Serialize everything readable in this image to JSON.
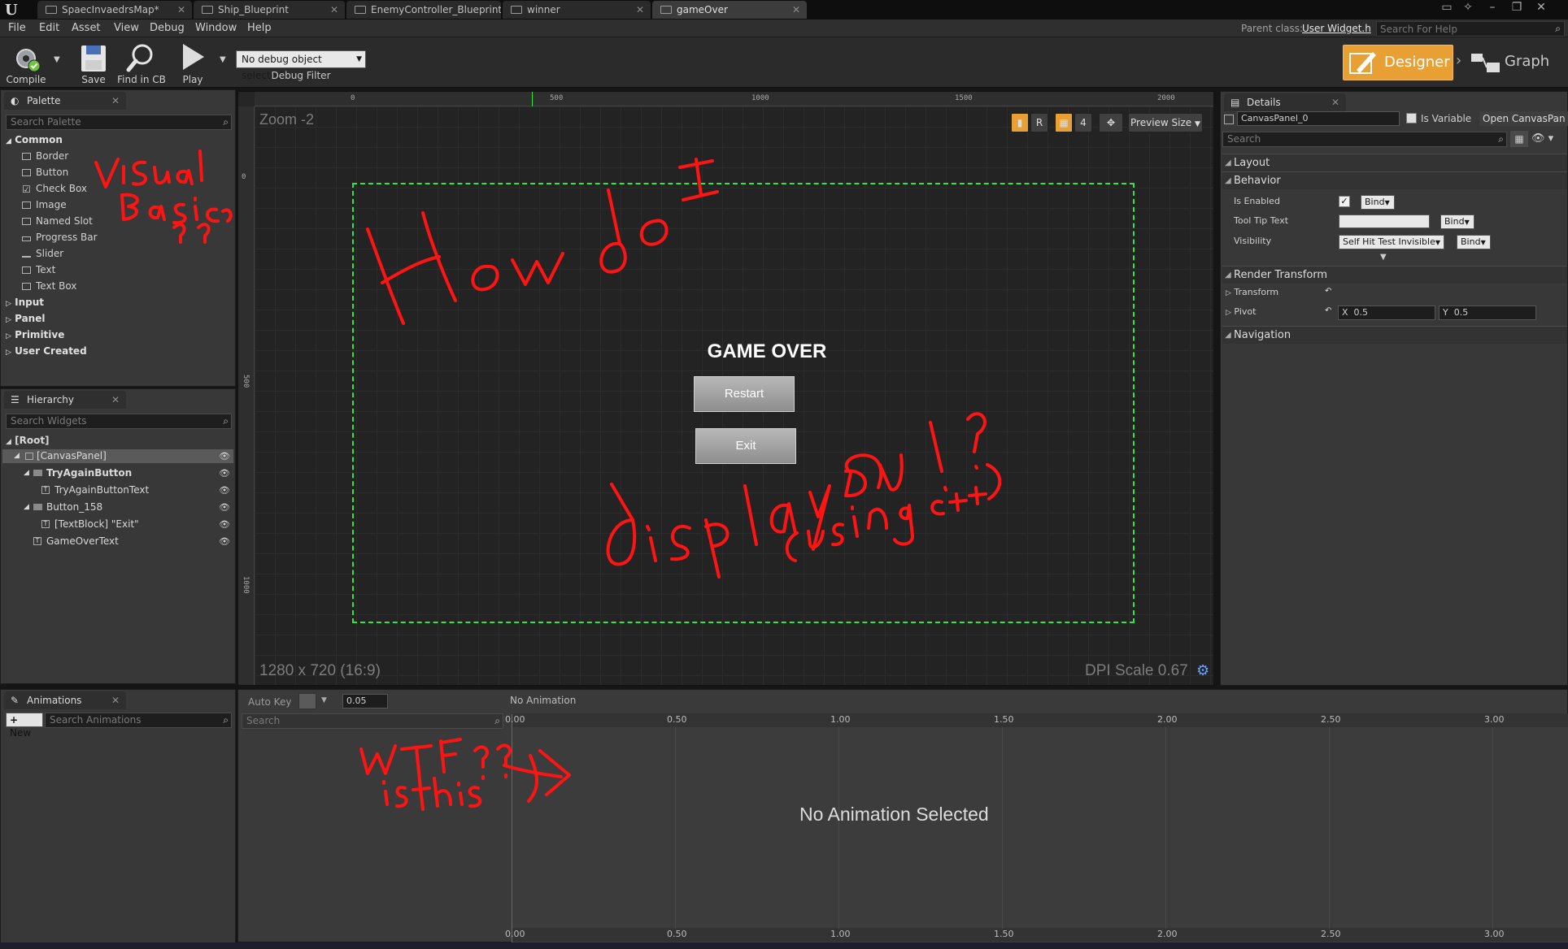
{
  "tabs": [
    {
      "label": "SpaecInvaedrsMap*",
      "active": false
    },
    {
      "label": "Ship_Blueprint",
      "active": false
    },
    {
      "label": "EnemyController_Blueprint",
      "active": false
    },
    {
      "label": "winner",
      "active": false
    },
    {
      "label": "gameOver",
      "active": true
    }
  ],
  "menu": [
    "File",
    "Edit",
    "Asset",
    "View",
    "Debug",
    "Window",
    "Help"
  ],
  "parent_class_label": "Parent class:",
  "parent_class_value": "User Widget.h",
  "help_search_placeholder": "Search For Help",
  "toolbar": {
    "compile": "Compile",
    "save": "Save",
    "find_in_cb": "Find in CB",
    "play": "Play",
    "debug_select": "No debug object selected",
    "debug_filter": "Debug Filter",
    "designer": "Designer",
    "graph": "Graph"
  },
  "palette": {
    "title": "Palette",
    "search_placeholder": "Search Palette",
    "common_label": "Common",
    "common_items": [
      "Border",
      "Button",
      "Check Box",
      "Image",
      "Named Slot",
      "Progress Bar",
      "Slider",
      "Text",
      "Text Box"
    ],
    "categories": [
      "Input",
      "Panel",
      "Primitive",
      "User Created"
    ]
  },
  "hierarchy": {
    "title": "Hierarchy",
    "search_placeholder": "Search Widgets",
    "root": "[Root]",
    "rows": [
      {
        "label": "[CanvasPanel]"
      },
      {
        "label": "TryAgainButton"
      },
      {
        "label": "TryAgainButtonText"
      },
      {
        "label": "Button_158"
      },
      {
        "label": "[TextBlock] \"Exit\""
      },
      {
        "label": "GameOverText"
      }
    ]
  },
  "viewport": {
    "zoom": "Zoom -2",
    "resolution": "1280 x 720 (16:9)",
    "dpi": "DPI Scale 0.67",
    "preview_size": "Preview Size",
    "r_toggle": "R",
    "grid_count": "4",
    "ruler_h": [
      "0",
      "500",
      "1000",
      "1500",
      "2000"
    ],
    "ruler_v": [
      "0",
      "500",
      "1000"
    ],
    "game_over_text": "GAME OVER",
    "restart_label": "Restart",
    "exit_label": "Exit"
  },
  "details": {
    "title": "Details",
    "name_value": "CanvasPanel_0",
    "is_variable": "Is Variable",
    "open_link": "Open CanvasPan",
    "search_placeholder": "Search",
    "sections": {
      "layout": "Layout",
      "behavior": "Behavior",
      "render_transform": "Render Transform",
      "navigation": "Navigation"
    },
    "is_enabled": "Is Enabled",
    "tool_tip_text": "Tool Tip Text",
    "visibility": "Visibility",
    "visibility_value": "Self Hit Test Invisible",
    "bind": "Bind",
    "transform": "Transform",
    "pivot": "Pivot",
    "pivot_x_label": "X",
    "pivot_x": "0.5",
    "pivot_y_label": "Y",
    "pivot_y": "0.5"
  },
  "animations": {
    "title": "Animations",
    "new_label": "New",
    "search_placeholder": "Search Animations"
  },
  "timeline": {
    "auto_key": "Auto Key",
    "snap_value": "0.05",
    "no_animation": "No Animation",
    "search_placeholder": "Search",
    "ticks": [
      "0.00",
      "0.50",
      "1.00",
      "1.50",
      "2.00",
      "2.50",
      "3.00"
    ],
    "no_anim_selected": "No Animation Selected"
  },
  "colors": {
    "accent": "#e8a035",
    "canvas_border": "#2ee83b",
    "annotation": "#ff1414"
  }
}
